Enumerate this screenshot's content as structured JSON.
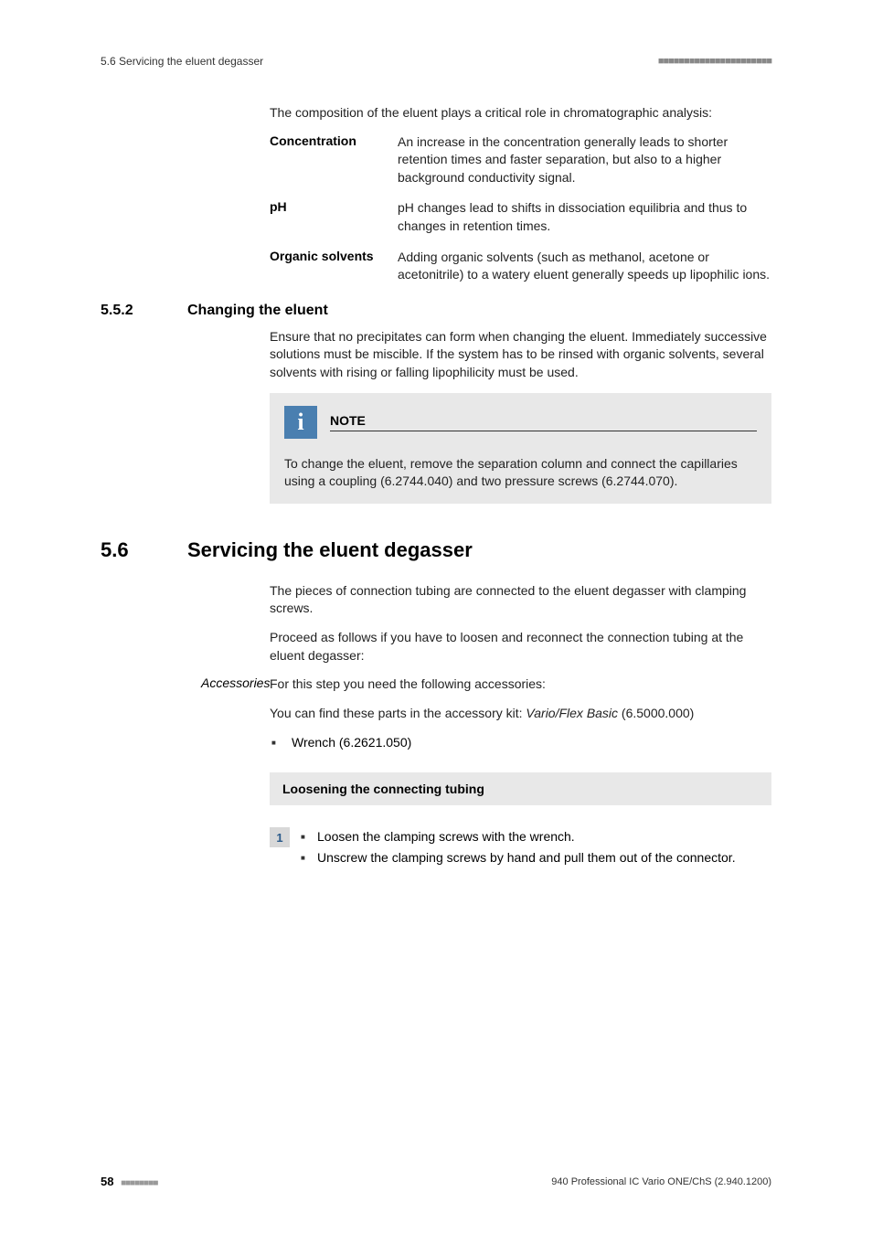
{
  "header": {
    "left": "5.6 Servicing the eluent degasser",
    "dots": "■■■■■■■■■■■■■■■■■■■■■■"
  },
  "intro": "The composition of the eluent plays a critical role in chromatographic analysis:",
  "definitions": [
    {
      "term": "Concentration",
      "desc": "An increase in the concentration generally leads to shorter retention times and faster separation, but also to a higher background conductivity signal."
    },
    {
      "term": "pH",
      "desc": "pH changes lead to shifts in dissociation equilibria and thus to changes in retention times."
    },
    {
      "term": "Organic solvents",
      "desc": "Adding organic solvents (such as methanol, acetone or acetonitrile) to a watery eluent generally speeds up lipophilic ions."
    }
  ],
  "subsection": {
    "num": "5.5.2",
    "title": "Changing the eluent",
    "para": "Ensure that no precipitates can form when changing the eluent. Immediately successive solutions must be miscible. If the system has to be rinsed with organic solvents, several solvents with rising or falling lipophilicity must be used."
  },
  "note": {
    "label": "NOTE",
    "text": "To change the eluent, remove the separation column and connect the capillaries using a coupling (6.2744.040) and two pressure screws (6.2744.070)."
  },
  "section": {
    "num": "5.6",
    "title": "Servicing the eluent degasser",
    "p1": "The pieces of connection tubing are connected to the eluent degasser with clamping screws.",
    "p2": "Proceed as follows if you have to loosen and reconnect the connection tubing at the eluent degasser:"
  },
  "accessories": {
    "sideLabel": "Accessories",
    "lead": "For this step you need the following accessories:",
    "kitPrefix": "You can find these parts in the accessory kit: ",
    "kitName": "Vario/Flex Basic",
    "kitNumber": " (6.5000.000)",
    "items": [
      "Wrench (6.2621.050)"
    ]
  },
  "procedure": {
    "title": "Loosening the connecting tubing",
    "stepNum": "1",
    "bullets": [
      "Loosen the clamping screws with the wrench.",
      "Unscrew the clamping screws by hand and pull them out of the connector."
    ]
  },
  "footer": {
    "page": "58",
    "dots": "■■■■■■■■",
    "right": "940 Professional IC Vario ONE/ChS (2.940.1200)"
  }
}
